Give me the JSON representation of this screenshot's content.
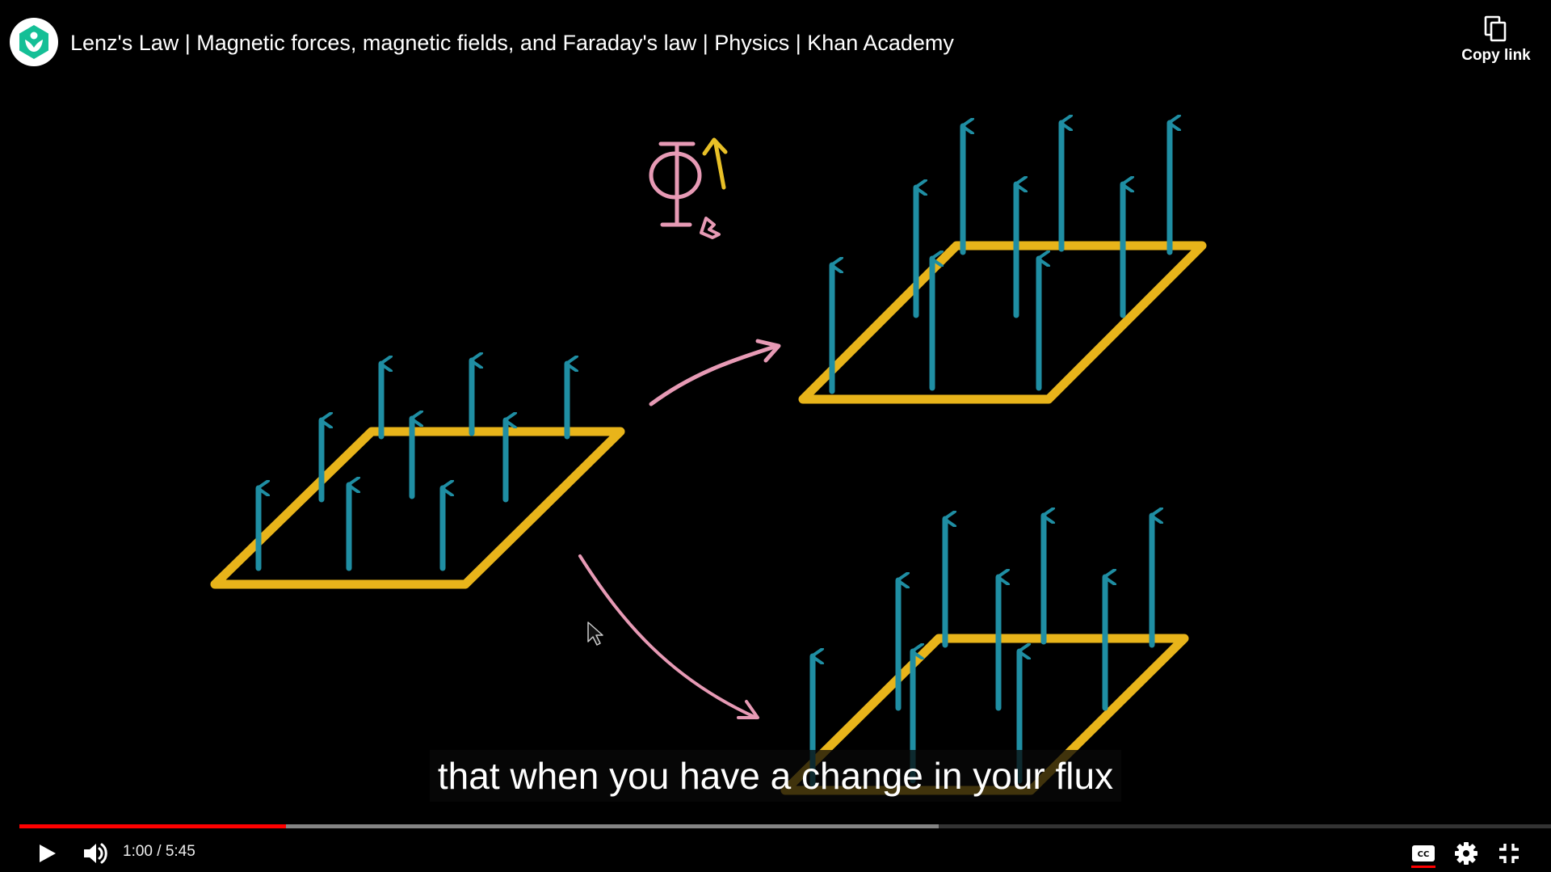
{
  "header": {
    "title": "Lenz's Law | Magnetic forces, magnetic fields, and Faraday's law | Physics | Khan Academy",
    "channel_icon": "khan-academy-logo",
    "copy_link_label": "Copy link",
    "copy_link_icon": "copy-icon"
  },
  "video": {
    "caption": "that when you have a change in your flux"
  },
  "player": {
    "current_time": "1:00",
    "duration": "5:45",
    "time_separator": " / ",
    "played_fraction": 0.174,
    "loaded_fraction": 0.6,
    "icons": {
      "play": "play-icon",
      "volume": "volume-icon",
      "captions": "closed-captions-icon",
      "settings": "gear-icon",
      "fullscreen_exit": "exit-fullscreen-icon"
    }
  },
  "colors": {
    "loop": "#e8b41a",
    "field_arrow": "#1f8ea3",
    "chalk_pink": "#e79ab5",
    "chalk_yellow": "#e8c027",
    "progress_red": "#ff0000",
    "brand_green": "#14bf96"
  }
}
